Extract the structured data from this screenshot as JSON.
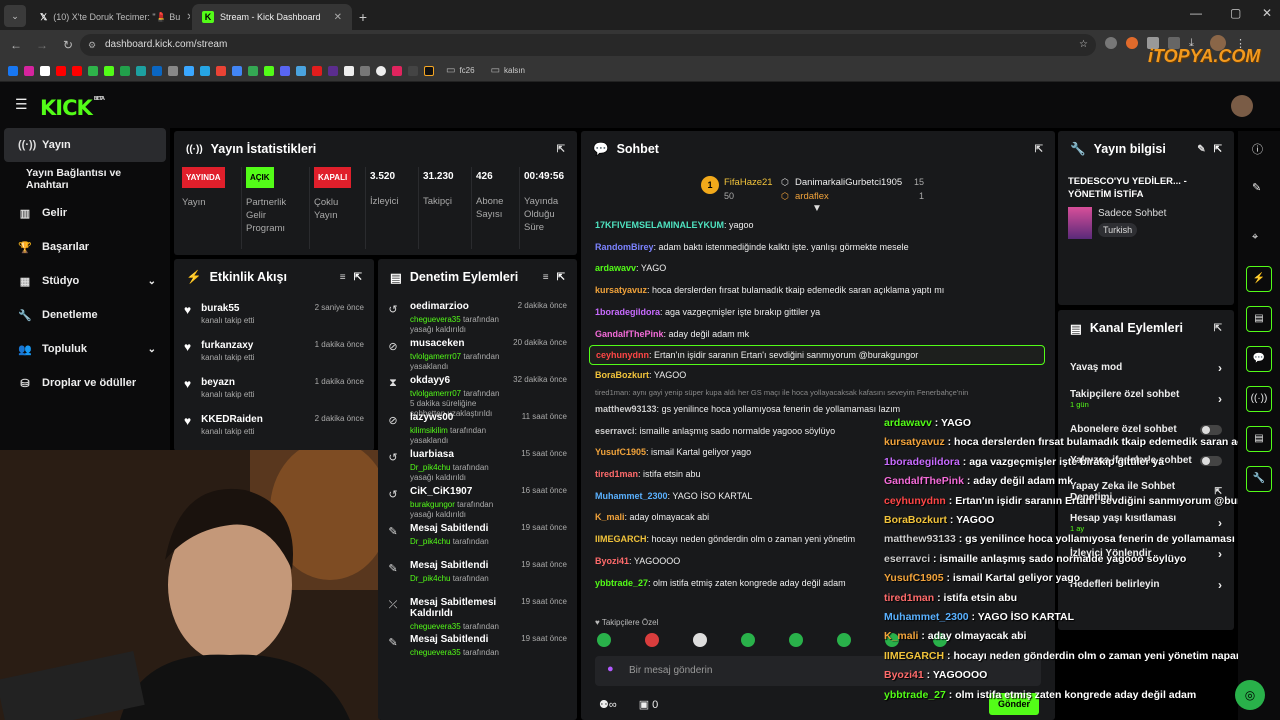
{
  "browser": {
    "tabs": [
      {
        "label": "(10) X'te Doruk Tecimer: \"💄 Bu",
        "active": false
      },
      {
        "label": "Stream - Kick Dashboard",
        "active": true
      }
    ],
    "new_tab": "+",
    "url": "dashboard.kick.com/stream",
    "bookmark_folders": [
      "fc26",
      "kalsın"
    ],
    "watermark": "iTOPYA.COM"
  },
  "app": {
    "logo": "KICK",
    "logo_badge": "BETA",
    "accent": "#53fc18"
  },
  "sidebar": {
    "items": [
      {
        "icon": "broadcast-icon",
        "label": "Yayın",
        "active": true,
        "expandable": false
      },
      {
        "icon": "",
        "label": "Yayın Bağlantısı ve Anahtarı",
        "active": false,
        "expandable": false
      },
      {
        "icon": "income-icon",
        "label": "Gelir",
        "active": false,
        "expandable": false
      },
      {
        "icon": "trophy-icon",
        "label": "Başarılar",
        "active": false,
        "expandable": false
      },
      {
        "icon": "studio-icon",
        "label": "Stüdyo",
        "active": false,
        "expandable": true
      },
      {
        "icon": "wrench-icon",
        "label": "Denetleme",
        "active": false,
        "expandable": false
      },
      {
        "icon": "community-icon",
        "label": "Topluluk",
        "active": false,
        "expandable": true
      },
      {
        "icon": "drops-icon",
        "label": "Droplar ve ödüller",
        "active": false,
        "expandable": false
      }
    ]
  },
  "stats": {
    "title": "Yayın İstatistikleri",
    "items": [
      {
        "badge": "YAYINDA",
        "badge_color": "#e01f2b",
        "label": "Yayın"
      },
      {
        "badge": "AÇIK",
        "badge_color": "#53fc18",
        "label": "Partnerlik Gelir Programı"
      },
      {
        "badge": "KAPALI",
        "badge_color": "#e01f2b",
        "label": "Çoklu Yayın"
      },
      {
        "value": "3.520",
        "label": "İzleyici"
      },
      {
        "value": "31.230",
        "label": "Takipçi"
      },
      {
        "value": "426",
        "label": "Abone Sayısı"
      },
      {
        "value": "00:49:56",
        "label": "Yayında Olduğu Süre"
      }
    ]
  },
  "activity": {
    "title": "Etkinlik Akışı",
    "items": [
      {
        "name": "burak55",
        "sub": "kanalı takip etti",
        "time": "2 saniye önce"
      },
      {
        "name": "furkanzaxy",
        "sub": "kanalı takip etti",
        "time": "1 dakika önce"
      },
      {
        "name": "beyazn",
        "sub": "kanalı takip etti",
        "time": "1 dakika önce"
      },
      {
        "name": "KKEDRaiden",
        "sub": "kanalı takip etti",
        "time": "2 dakika önce"
      }
    ]
  },
  "moderation": {
    "title": "Denetim Eylemleri",
    "items": [
      {
        "icon": "undo-icon",
        "name": "oedimarzioo",
        "by": "cheguevera35",
        "rest": " tarafından yasağı kaldırıldı",
        "time": "2 dakika önce"
      },
      {
        "icon": "ban-icon",
        "name": "musaceken",
        "by": "tvlolgamerrr07",
        "rest": " tarafından yasaklandı",
        "time": "20 dakika önce"
      },
      {
        "icon": "hourglass-icon",
        "name": "okdayy6",
        "by": "tvlolgamerrr07",
        "rest": " tarafından 5 dakika süreliğine sohbetten uzaklaştırıldı",
        "time": "32 dakika önce"
      },
      {
        "icon": "ban-icon",
        "name": "lazyws00",
        "by": "kilimsikilim",
        "rest": " tarafından yasaklandı",
        "time": "11 saat önce"
      },
      {
        "icon": "undo-icon",
        "name": "luarbiasa",
        "by": "Dr_pik4chu",
        "rest": " tarafından yasağı kaldırıldı",
        "time": "15 saat önce"
      },
      {
        "icon": "undo-icon",
        "name": "CiK_CiK1907",
        "by": "burakgungor",
        "rest": " tarafından yasağı kaldırıldı",
        "time": "16 saat önce"
      },
      {
        "icon": "pin-icon",
        "name": "Mesaj Sabitlendi",
        "by": "Dr_pik4chu",
        "rest": " tarafından",
        "time": "19 saat önce"
      },
      {
        "icon": "pin-icon",
        "name": "Mesaj Sabitlendi",
        "by": "Dr_pik4chu",
        "rest": " tarafından",
        "time": "19 saat önce"
      },
      {
        "icon": "unpin-icon",
        "name": "Mesaj Sabitlemesi Kaldırıldı",
        "by": "cheguevera35",
        "rest": " tarafından",
        "time": "19 saat önce"
      },
      {
        "icon": "pin-icon",
        "name": "Mesaj Sabitlendi",
        "by": "cheguevera35",
        "rest": " tarafından",
        "time": "19 saat önce"
      }
    ]
  },
  "chat": {
    "title": "Sohbet",
    "leaderboard": [
      {
        "rank": "1",
        "name": "FifaHaze21",
        "count": "50"
      },
      {
        "name": "DanimarkaliGurbetci1905",
        "count": "15"
      },
      {
        "name": "ardaflex",
        "count": "1"
      }
    ],
    "messages": [
      {
        "user": "17KFIVEMSELAMINALEYKUM",
        "color": "#4fe3c1",
        "text": "yagoo"
      },
      {
        "user": "RandomBirey",
        "color": "#7c83ff",
        "text": "adam baktı istenmediğinde kalktı işte. yanlışı görmekte mesele"
      },
      {
        "user": "ardawavv",
        "color": "#53fc18",
        "text": "YAGO"
      },
      {
        "user": "kursatyavuz",
        "color": "#f1a33b",
        "text": "hoca derslerden fırsat bulamadık tkaip edemedik saran açıklama yaptı mı"
      },
      {
        "user": "1boradegildora",
        "color": "#c86bff",
        "text": "aga vazgeçmişler işte bırakıp gittiler ya"
      },
      {
        "user": "GandalfThePink",
        "color": "#f36bd8",
        "text": "aday değil adam mk"
      },
      {
        "user": "ceyhunydnn",
        "color": "#ff4646",
        "text": "Ertan'ın işidir saranın Ertan'ı sevdiğini sanmıyorum @burakgungor",
        "highlight": true
      },
      {
        "user": "BoraBozkurt",
        "color": "#f1c33b",
        "text": "YAGOO"
      },
      {
        "user": "matthew93133",
        "color": "#cccccc",
        "text": "gs yenilince hoca yollamıyosa fenerin de yollamaması lazım"
      },
      {
        "user": "eserravci",
        "color": "#cccccc",
        "text": "ismaille anlaşmış sado normalde yagooo söylüyo"
      },
      {
        "user": "YusufC1905",
        "color": "#f1a33b",
        "text": "ismail Kartal geliyor yago"
      },
      {
        "user": "tired1man",
        "color": "#ff6b6b",
        "text": "istifa etsin abu"
      },
      {
        "user": "Muhammet_2300",
        "color": "#5ab1ff",
        "text": "YAGO İSO KARTAL"
      },
      {
        "user": "K_mali",
        "color": "#f1a33b",
        "text": "aday olmayacak abi"
      },
      {
        "user": "IIMEGARCH",
        "color": "#f1c33b",
        "text": "hocayı neden gönderdin olm o zaman yeni yönetim"
      },
      {
        "user": "Byozi41",
        "color": "#ff6b6b",
        "text": "YAGOOOO"
      },
      {
        "user": "ybbtrade_27",
        "color": "#53fc18",
        "text": "olm istifa etmiş zaten kongrede aday değil adam"
      }
    ],
    "pinned_hint": "tired1man: aynı gayi yenip süper kupa aldı her GS maçı ile hoca yollayacaksak kafasını seveyim Fenerbahçe'nin",
    "followers_mode": "Takipçilere Özel",
    "input_placeholder": "Bir mesaj gönderin",
    "send_label": "Gönder",
    "footer_count": "0"
  },
  "overlay": {
    "lines": [
      {
        "user": "ardawavv",
        "color": "#53fc18",
        "text": "YAGO"
      },
      {
        "user": "kursatyavuz",
        "color": "#f1a33b",
        "text": "hoca derslerden fırsat bulamadık tkaip edemedik saran açıklama yaptı mı"
      },
      {
        "user": "1boradegildora",
        "color": "#c86bff",
        "text": "aga vazgeçmişler işte bırakıp gittiler ya"
      },
      {
        "user": "GandalfThePink",
        "color": "#f36bd8",
        "text": "aday değil adam mk"
      },
      {
        "user": "ceyhunydnn",
        "color": "#ff4646",
        "text": "Ertan'ın işidir saranın Ertan'ı sevdiğini sanmıyorum @burakgungor"
      },
      {
        "user": "BoraBozkurt",
        "color": "#f1c33b",
        "text": "YAGOO"
      },
      {
        "user": "matthew93133",
        "color": "#cccccc",
        "text": "gs yenilince hoca yollamıyosa fenerin de yollamaması lazım"
      },
      {
        "user": "eserravci",
        "color": "#cccccc",
        "text": "ismaille anlaşmış sado normalde yagooo söylüyo"
      },
      {
        "user": "YusufC1905",
        "color": "#f1a33b",
        "text": "ismail Kartal geliyor yago"
      },
      {
        "user": "tired1man",
        "color": "#ff6b6b",
        "text": "istifa etsin abu"
      },
      {
        "user": "Muhammet_2300",
        "color": "#5ab1ff",
        "text": "YAGO İSO KARTAL"
      },
      {
        "user": "K_mali",
        "color": "#f1a33b",
        "text": "aday olmayacak abi"
      },
      {
        "user": "IIMEGARCH",
        "color": "#f1c33b",
        "text": "hocayı neden gönderdin olm o zaman yeni yönetim naparsa yapsaydı"
      },
      {
        "user": "Byozi41",
        "color": "#ff6b6b",
        "text": "YAGOOOO"
      },
      {
        "user": "ybbtrade_27",
        "color": "#53fc18",
        "text": "olm istifa etmiş zaten kongrede aday değil adam"
      }
    ]
  },
  "stream_info": {
    "title": "Yayın bilgisi",
    "stream_title": "TEDESCO'YU YEDİLER... - YÖNETİM İSTİFA",
    "category": "Sadece Sohbet",
    "tag": "Turkish"
  },
  "channel_actions": {
    "title": "Kanal Eylemleri",
    "items": [
      {
        "label": "Yavaş mod",
        "sub": "",
        "control": "arrow"
      },
      {
        "label": "Takipçilere özel sohbet",
        "sub": "1 gün",
        "control": "arrow"
      },
      {
        "label": "Abonelere özel sohbet",
        "sub": "",
        "control": "toggle"
      },
      {
        "label": "Yalnızca ifadelerle sohbet",
        "sub": "",
        "control": "toggle"
      },
      {
        "label": "Yapay Zeka ile Sohbet Denetimi",
        "sub": "",
        "control": "external"
      },
      {
        "label": "Hesap yaşı kısıtlaması",
        "sub": "1 ay",
        "control": "arrow"
      },
      {
        "label": "İzleyici Yönlendir",
        "sub": "",
        "control": "arrow"
      },
      {
        "label": "Hedefleri belirleyin",
        "sub": "",
        "control": "arrow"
      }
    ]
  }
}
